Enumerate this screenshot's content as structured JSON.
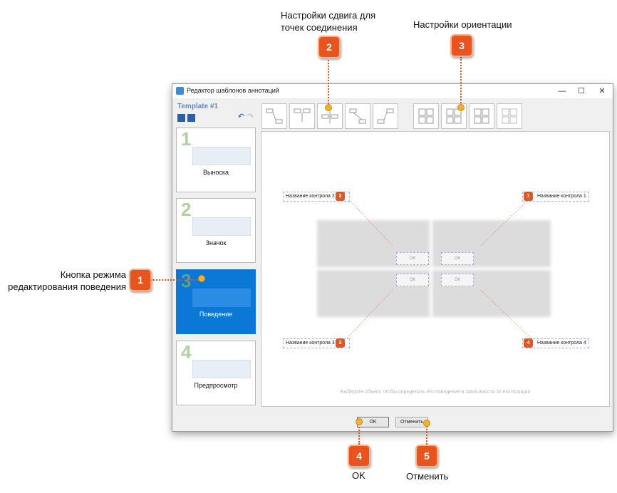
{
  "callouts": {
    "c1": {
      "number": "1",
      "text_line1": "Кнопка режима",
      "text_line2": "редактирования поведения"
    },
    "c2": {
      "number": "2",
      "text_line1": "Настройки сдвига для",
      "text_line2": "точек соединения"
    },
    "c3": {
      "number": "3",
      "text": "Настройки ориентации"
    },
    "c4": {
      "number": "4",
      "text": "OK"
    },
    "c5": {
      "number": "5",
      "text": "Отменить"
    }
  },
  "window": {
    "title": "Редактор шаблонов аннотаций",
    "controls": {
      "minimize": "—",
      "maximize": "☐",
      "close": "✕"
    }
  },
  "sidebar": {
    "template_title": "Template #1",
    "items": [
      {
        "num": "1",
        "label": "Выноска",
        "active": false
      },
      {
        "num": "2",
        "label": "Значок",
        "active": false
      },
      {
        "num": "3",
        "label": "Поведение",
        "active": true
      },
      {
        "num": "4",
        "label": "Предпросмотр",
        "active": false
      }
    ]
  },
  "canvas": {
    "controls": [
      {
        "num": "1",
        "label": "Название контрола 1"
      },
      {
        "num": "2",
        "label": "Название контрола 2"
      },
      {
        "num": "3",
        "label": "Название контрола 3"
      },
      {
        "num": "4",
        "label": "Название контрола 4"
      }
    ],
    "ok_label": "OK",
    "hint": "Выберите объект, чтобы определить его поведение в зависимости от его позиции"
  },
  "footer": {
    "ok": "OK",
    "cancel": "Отменить"
  },
  "colors": {
    "accent": "#e8541d",
    "active_tab": "#0b78d7",
    "dot": "#f0b030"
  }
}
